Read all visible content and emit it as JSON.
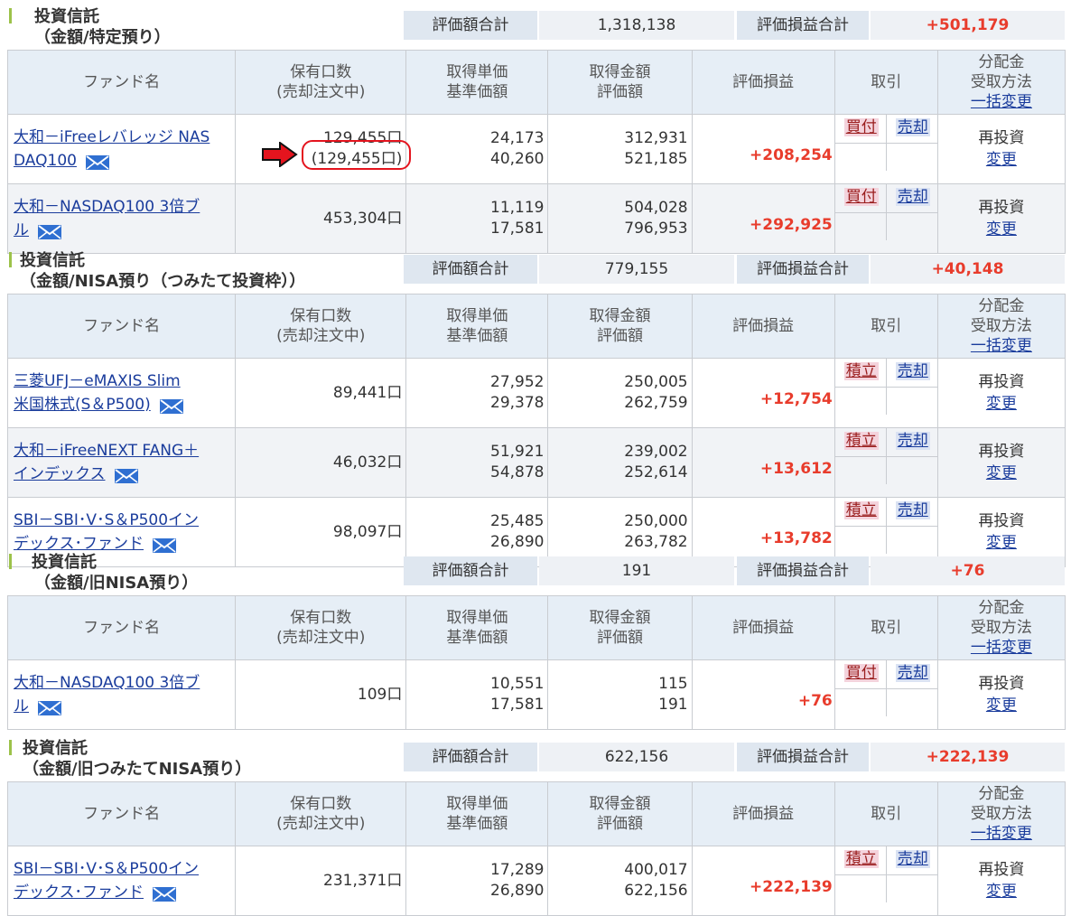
{
  "mail_icon": "envelope-icon",
  "arrow_icon": "red-arrow-icon",
  "colors": {
    "accent_green": "#9cc24a",
    "profit_red": "#e83c2c",
    "link_blue": "#1a3c9c",
    "buy_bg": "#f4d3dc",
    "sell_bg": "#dbe3f3",
    "header_bg": "#e6eef6"
  },
  "columns": {
    "fund_name": "ファンド名",
    "units_1": "保有口数",
    "units_2": "(売却注文中)",
    "acq_1": "取得単価",
    "acq_2": "基準価額",
    "amount_1": "取得金額",
    "amount_2": "評価額",
    "pl": "評価損益",
    "trade": "取引",
    "dist_1": "分配金",
    "dist_2": "受取方法",
    "dist_3": "一括変更"
  },
  "summary_labels": {
    "total": "評価額合計",
    "pl_total": "評価損益合計"
  },
  "dist_reinvest": "再投資",
  "dist_change": "変更",
  "sections": [
    {
      "title1": "投資信託",
      "title2": "（金額/特定預り）",
      "total": "1,318,138",
      "pl_total": "+501,179",
      "funds": [
        {
          "name1": "大和－iFreeレバレッジ NAS",
          "name2": "DAQ100",
          "units": "129,455口",
          "pending": "(129,455口)",
          "acq_price": "24,173",
          "base_price": "40,260",
          "acq_amount": "312,931",
          "eval_amount": "521,185",
          "pl": "+208,254",
          "buy": "買付",
          "sell": "売却"
        },
        {
          "name1": "大和－NASDAQ100 3倍ブ",
          "name2": "ル",
          "units": "453,304口",
          "pending": "",
          "acq_price": "11,119",
          "base_price": "17,581",
          "acq_amount": "504,028",
          "eval_amount": "796,953",
          "pl": "+292,925",
          "buy": "買付",
          "sell": "売却"
        }
      ]
    },
    {
      "title1": "投資信託",
      "title2": "（金額/NISA預り（つみたて投資枠））",
      "total": "779,155",
      "pl_total": "+40,148",
      "funds": [
        {
          "name1": "三菱UFJ－eMAXIS Slim",
          "name2": "米国株式(S＆P500)",
          "units": "89,441口",
          "pending": "",
          "acq_price": "27,952",
          "base_price": "29,378",
          "acq_amount": "250,005",
          "eval_amount": "262,759",
          "pl": "+12,754",
          "buy": "積立",
          "sell": "売却"
        },
        {
          "name1": "大和－iFreeNEXT FANG＋",
          "name2": "インデックス",
          "units": "46,032口",
          "pending": "",
          "acq_price": "51,921",
          "base_price": "54,878",
          "acq_amount": "239,002",
          "eval_amount": "252,614",
          "pl": "+13,612",
          "buy": "積立",
          "sell": "売却"
        },
        {
          "name1": "SBI－SBI･V･S＆P500イン",
          "name2": "デックス･ファンド",
          "units": "98,097口",
          "pending": "",
          "acq_price": "25,485",
          "base_price": "26,890",
          "acq_amount": "250,000",
          "eval_amount": "263,782",
          "pl": "+13,782",
          "buy": "積立",
          "sell": "売却"
        }
      ]
    },
    {
      "title1": "投資信託",
      "title2": "（金額/旧NISA預り）",
      "total": "191",
      "pl_total": "+76",
      "funds": [
        {
          "name1": "大和－NASDAQ100 3倍ブ",
          "name2": "ル",
          "units": "109口",
          "pending": "",
          "acq_price": "10,551",
          "base_price": "17,581",
          "acq_amount": "115",
          "eval_amount": "191",
          "pl": "+76",
          "buy": "買付",
          "sell": "売却"
        }
      ]
    },
    {
      "title1": "投資信託",
      "title2": "（金額/旧つみたてNISA預り）",
      "total": "622,156",
      "pl_total": "+222,139",
      "funds": [
        {
          "name1": "SBI－SBI･V･S＆P500イン",
          "name2": "デックス･ファンド",
          "units": "231,371口",
          "pending": "",
          "acq_price": "17,289",
          "base_price": "26,890",
          "acq_amount": "400,017",
          "eval_amount": "622,156",
          "pl": "+222,139",
          "buy": "積立",
          "sell": "売却"
        }
      ]
    }
  ]
}
